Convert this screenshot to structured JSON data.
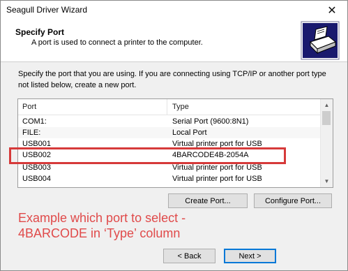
{
  "window": {
    "title": "Seagull Driver Wizard",
    "close_glyph": "✕"
  },
  "header": {
    "title": "Specify Port",
    "subtitle": "A port is used to connect a printer to the computer.",
    "icon": "printer-icon"
  },
  "instructions": "Specify the port that you are using.  If you are connecting using TCP/IP or another port type not listed below, create a new port.",
  "port_list": {
    "columns": [
      "Port",
      "Type"
    ],
    "rows": [
      {
        "port": "COM1:",
        "type": "Serial Port (9600:8N1)"
      },
      {
        "port": "FILE:",
        "type": "Local Port"
      },
      {
        "port": "USB001",
        "type": "Virtual printer port for USB"
      },
      {
        "port": "USB002",
        "type": "4BARCODE4B-2054A"
      },
      {
        "port": "USB003",
        "type": "Virtual printer port for USB"
      },
      {
        "port": "USB004",
        "type": "Virtual printer port for USB"
      }
    ]
  },
  "buttons": {
    "create_port": "Create Port...",
    "configure_port": "Configure Port...",
    "back": "< Back",
    "next": "Next >"
  },
  "annotation": {
    "line1": "Example which port to select -",
    "line2": "4BARCODE in ‘Type’ column",
    "color": "#e04a4a"
  },
  "colors": {
    "highlight_border": "#d63a3a",
    "default_button_border": "#0078d7"
  }
}
